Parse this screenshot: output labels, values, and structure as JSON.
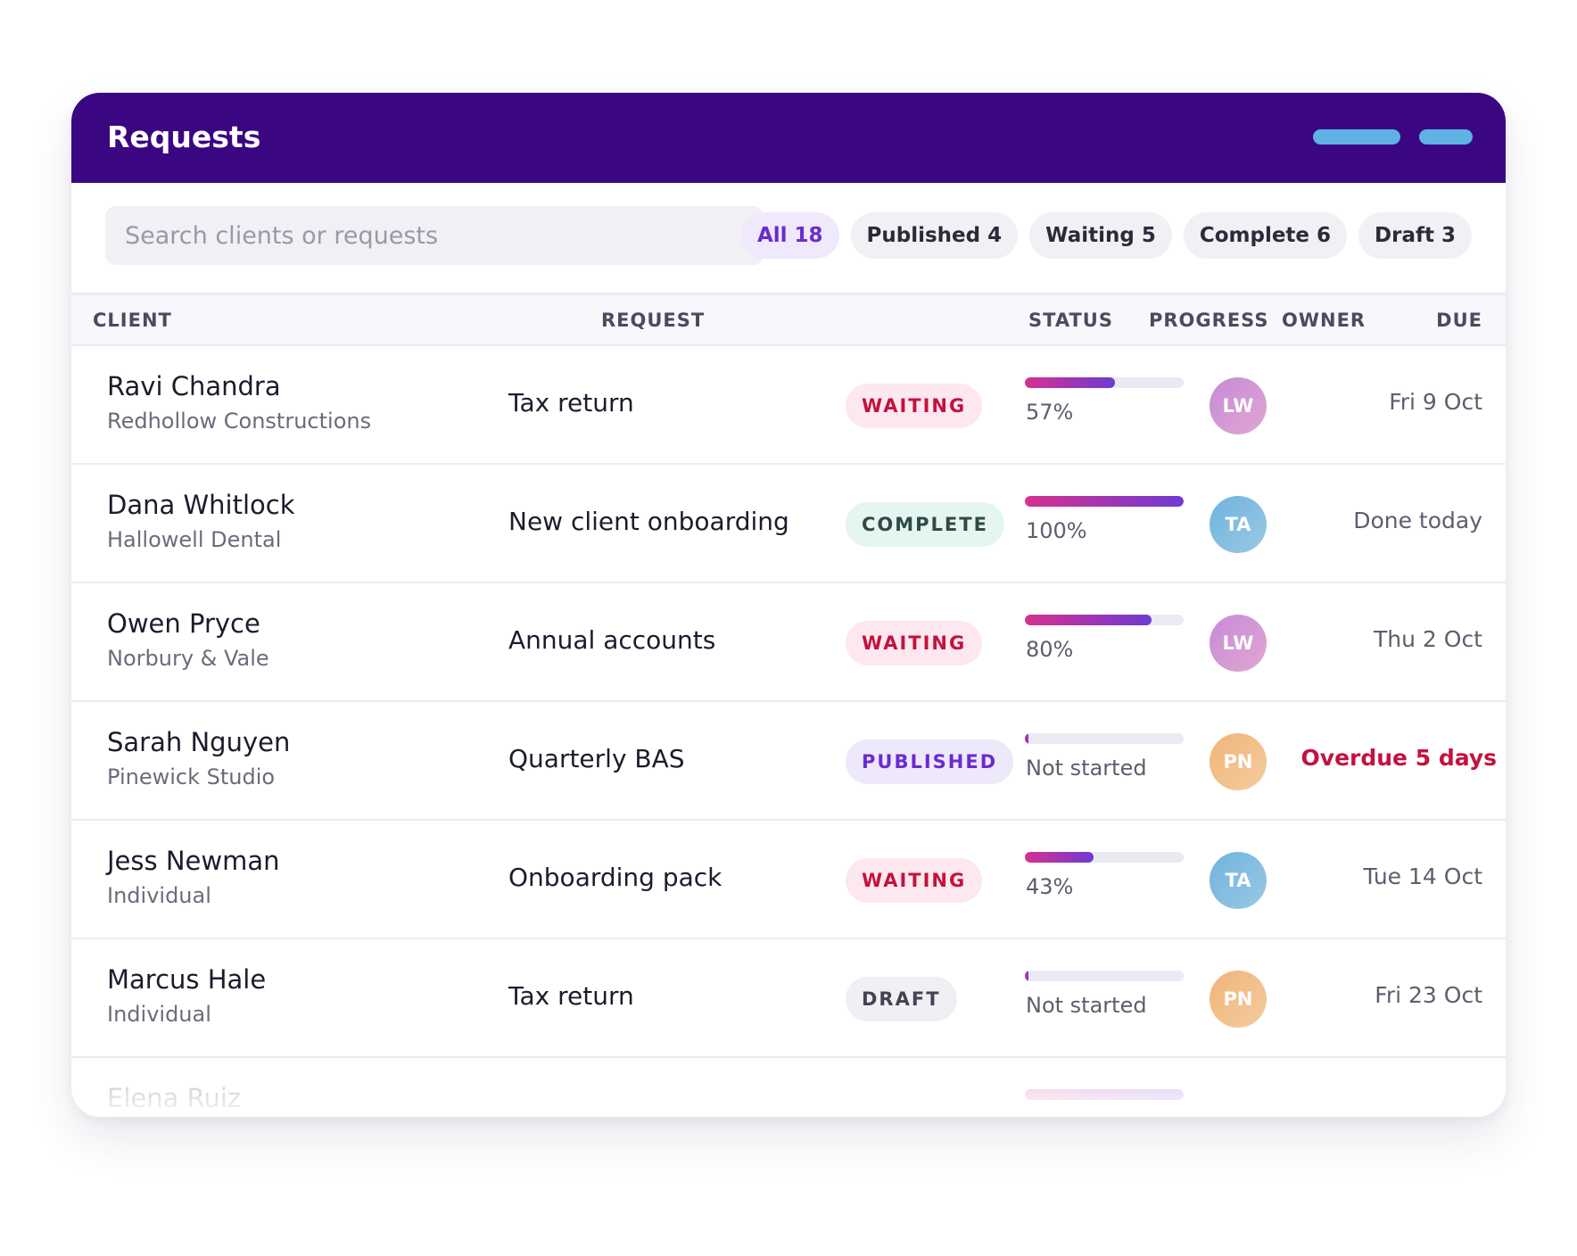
{
  "header": {
    "title": "Requests"
  },
  "search": {
    "placeholder": "Search clients or requests",
    "value": ""
  },
  "filters": [
    {
      "label": "All 18",
      "active": true
    },
    {
      "label": "Published 4",
      "active": false
    },
    {
      "label": "Waiting 5",
      "active": false
    },
    {
      "label": "Complete 6",
      "active": false
    },
    {
      "label": "Draft 3",
      "active": false
    }
  ],
  "columns": {
    "client": "CLIENT",
    "request": "REQUEST",
    "status": "STATUS",
    "progress": "PROGRESS",
    "owner": "OWNER",
    "due": "DUE"
  },
  "colors": {
    "header_bg": "#3a0682",
    "header_pill": "#5eb2e4",
    "accent": "#6a2bd0",
    "overdue": "#c3123f",
    "progress_from": "#d6318f",
    "progress_to": "#6e3ad3"
  },
  "avatar_colors": {
    "LW": [
      "#c58ad8",
      "#e2a7d0"
    ],
    "TA": [
      "#6fb3df",
      "#9ac9e2"
    ],
    "PN": [
      "#f0b47a",
      "#f4cc9e"
    ]
  },
  "rows": [
    {
      "client": "Ravi Chandra",
      "org": "Redhollow Constructions",
      "request": "Tax return",
      "status": "WAITING",
      "status_type": "waiting",
      "progress": 57,
      "progress_label": "57%",
      "owner": "LW",
      "due": "Fri 9 Oct",
      "overdue": false
    },
    {
      "client": "Dana Whitlock",
      "org": "Hallowell Dental",
      "request": "New client onboarding",
      "status": "COMPLETE",
      "status_type": "complete",
      "progress": 100,
      "progress_label": "100%",
      "owner": "TA",
      "due": "Done today",
      "overdue": false
    },
    {
      "client": "Owen Pryce",
      "org": "Norbury & Vale",
      "request": "Annual accounts",
      "status": "WAITING",
      "status_type": "waiting",
      "progress": 80,
      "progress_label": "80%",
      "owner": "LW",
      "due": "Thu 2 Oct",
      "overdue": false
    },
    {
      "client": "Sarah Nguyen",
      "org": "Pinewick Studio",
      "request": "Quarterly BAS",
      "status": "PUBLISHED",
      "status_type": "published",
      "progress": 2,
      "progress_label": "Not started",
      "owner": "PN",
      "due": "Overdue 5 days",
      "overdue": true
    },
    {
      "client": "Jess Newman",
      "org": "Individual",
      "request": "Onboarding pack",
      "status": "WAITING",
      "status_type": "waiting",
      "progress": 43,
      "progress_label": "43%",
      "owner": "TA",
      "due": "Tue 14 Oct",
      "overdue": false
    },
    {
      "client": "Marcus Hale",
      "org": "Individual",
      "request": "Tax return",
      "status": "DRAFT",
      "status_type": "draft",
      "progress": 2,
      "progress_label": "Not started",
      "owner": "PN",
      "due": "Fri 23 Oct",
      "overdue": false
    }
  ],
  "partial_row": {
    "client": "Elena Ruiz",
    "progress": 100
  }
}
